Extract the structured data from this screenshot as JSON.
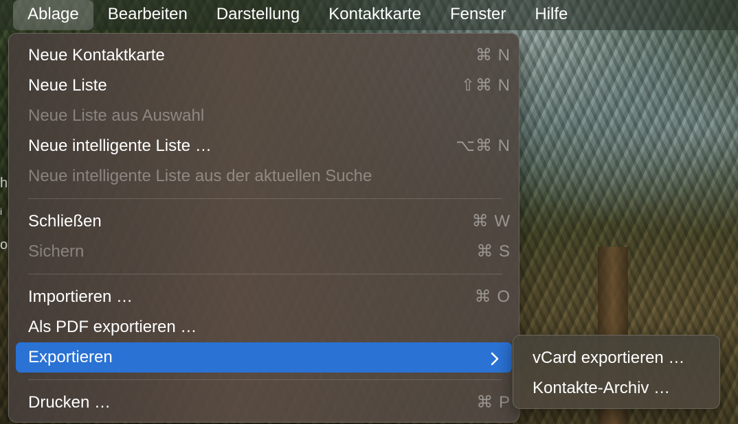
{
  "menubar": {
    "items": [
      {
        "label": "Ablage"
      },
      {
        "label": "Bearbeiten"
      },
      {
        "label": "Darstellung"
      },
      {
        "label": "Kontaktkarte"
      },
      {
        "label": "Fenster"
      },
      {
        "label": "Hilfe"
      }
    ]
  },
  "menu": {
    "items": [
      {
        "label": "Neue Kontaktkarte",
        "shortcut": "⌘ N",
        "enabled": true
      },
      {
        "label": "Neue Liste",
        "shortcut": "⇧⌘ N",
        "enabled": true
      },
      {
        "label": "Neue Liste aus Auswahl",
        "shortcut": "",
        "enabled": false
      },
      {
        "label": "Neue intelligente Liste …",
        "shortcut": "⌥⌘ N",
        "enabled": true
      },
      {
        "label": "Neue intelligente Liste aus der aktuellen Suche",
        "shortcut": "",
        "enabled": false
      },
      {
        "label": "Schließen",
        "shortcut": "⌘ W",
        "enabled": true
      },
      {
        "label": "Sichern",
        "shortcut": "⌘ S",
        "enabled": false
      },
      {
        "label": "Importieren …",
        "shortcut": "⌘ O",
        "enabled": true
      },
      {
        "label": "Als PDF exportieren …",
        "shortcut": "",
        "enabled": true
      },
      {
        "label": "Exportieren",
        "shortcut": "",
        "enabled": true,
        "highlighted": true,
        "has_submenu": true
      },
      {
        "label": "Drucken …",
        "shortcut": "⌘ P",
        "enabled": true
      }
    ]
  },
  "submenu": {
    "items": [
      {
        "label": "vCard exportieren …"
      },
      {
        "label": "Kontakte-Archiv …"
      }
    ]
  },
  "edge_fragments": [
    "h",
    "i",
    "o"
  ],
  "colors": {
    "highlight": "#2a72d4"
  }
}
